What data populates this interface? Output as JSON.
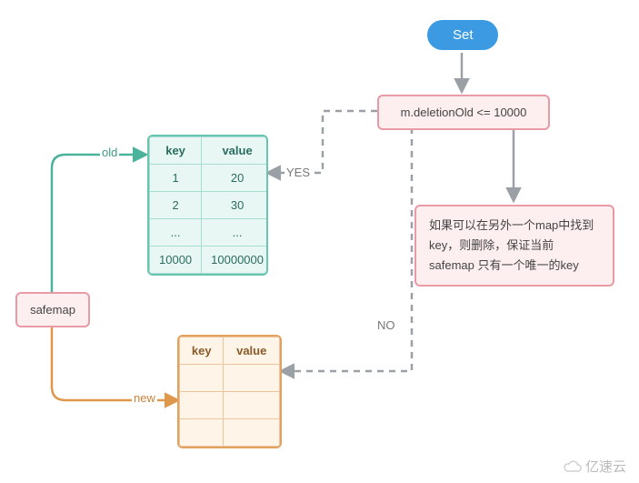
{
  "nodes": {
    "start": "Set",
    "condition": "m.deletionOld <= 10000",
    "safemap": "safemap",
    "message": "如果可以在另外一个map中找到 key，则删除，保证当前 safemap 只有一个唯一的key"
  },
  "edge_labels": {
    "old": "old",
    "new": "new",
    "yes": "YES",
    "no": "NO"
  },
  "green_table": {
    "headers": {
      "col1": "key",
      "col2": "value"
    },
    "rows": [
      {
        "k": "1",
        "v": "20"
      },
      {
        "k": "2",
        "v": "30"
      },
      {
        "k": "...",
        "v": "..."
      },
      {
        "k": "10000",
        "v": "10000000"
      }
    ]
  },
  "orange_table": {
    "headers": {
      "col1": "key",
      "col2": "value"
    }
  },
  "watermark": "亿速云",
  "colors": {
    "blue": "#3b9ae1",
    "pink_bg": "#fdeef0",
    "pink_border": "#e89aa5",
    "green_bg": "#e9f7f4",
    "green_border": "#68c5b0",
    "orange_bg": "#fff4e8",
    "orange_border": "#e2a15f",
    "dashed": "#9aa0a6"
  },
  "chart_data": {
    "type": "diagram",
    "description": "Flowchart of safemap.Set operation",
    "nodes": [
      {
        "id": "start",
        "type": "terminator",
        "label": "Set"
      },
      {
        "id": "cond",
        "type": "decision",
        "label": "m.deletionOld <= 10000"
      },
      {
        "id": "old_table",
        "type": "data",
        "label": "old map (key/value table)"
      },
      {
        "id": "new_table",
        "type": "data",
        "label": "new map (empty key/value table)"
      },
      {
        "id": "safemap",
        "type": "process",
        "label": "safemap"
      },
      {
        "id": "note",
        "type": "annotation",
        "label": "如果可以在另外一个map中找到 key，则删除，保证当前 safemap 只有一个唯一的key"
      }
    ],
    "edges": [
      {
        "from": "start",
        "to": "cond",
        "style": "solid"
      },
      {
        "from": "cond",
        "to": "old_table",
        "label": "YES",
        "style": "dashed"
      },
      {
        "from": "cond",
        "to": "new_table",
        "label": "NO",
        "style": "dashed"
      },
      {
        "from": "cond",
        "to": "note",
        "style": "solid"
      },
      {
        "from": "safemap",
        "to": "old_table",
        "label": "old",
        "style": "solid",
        "color": "green"
      },
      {
        "from": "safemap",
        "to": "new_table",
        "label": "new",
        "style": "solid",
        "color": "orange"
      }
    ]
  }
}
